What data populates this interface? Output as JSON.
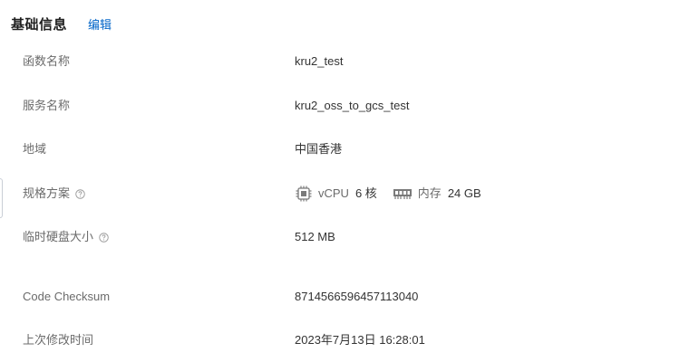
{
  "header": {
    "title": "基础信息",
    "edit_label": "编辑"
  },
  "rows": [
    {
      "label": "函数名称",
      "value": "kru2_test"
    },
    {
      "label": "服务名称",
      "value": "kru2_oss_to_gcs_test"
    },
    {
      "label": "地域",
      "value": "中国香港"
    },
    {
      "label": "规格方案",
      "has_help": true
    },
    {
      "label": "临时硬盘大小",
      "value": "512 MB",
      "has_help": true
    },
    {
      "label": "Code Checksum",
      "value": "8714566596457113040"
    },
    {
      "label": "上次修改时间",
      "value": "2023年7月13日 16:28:01"
    }
  ],
  "spec": {
    "cpu_icon": "cpu-chip-icon",
    "cpu_label": "vCPU",
    "cpu_value": "6 核",
    "mem_icon": "memory-module-icon",
    "mem_label": "内存",
    "mem_value": "24 GB"
  },
  "colors": {
    "link": "#0064c8",
    "label": "#6b6b6b",
    "value": "#333333"
  }
}
